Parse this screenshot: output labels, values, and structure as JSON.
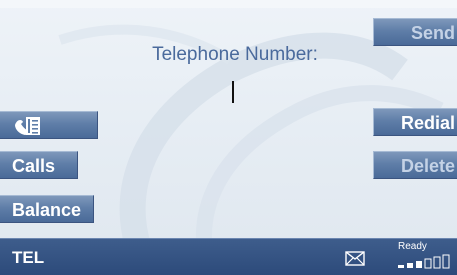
{
  "screen": {
    "title": "Telephone Number:",
    "number_value": ""
  },
  "left_softkeys": [
    {
      "label": "",
      "icon": "phonebook-icon",
      "enabled": true
    },
    {
      "label": "Calls",
      "enabled": true
    },
    {
      "label": "Balance",
      "enabled": true
    }
  ],
  "right_softkeys": [
    {
      "label": "Send",
      "enabled": false
    },
    {
      "label": "Redial",
      "enabled": true
    },
    {
      "label": "Delete",
      "enabled": false
    }
  ],
  "status_bar": {
    "mode": "TEL",
    "network_status": "Ready",
    "mail_icon": "envelope-icon",
    "signal_level": 0.5
  },
  "colors": {
    "button_blue": "#5f7ea8",
    "status_blue": "#2c4a7a",
    "label_blue": "#4a6a9c",
    "disabled_text": "#c4d2e6"
  }
}
